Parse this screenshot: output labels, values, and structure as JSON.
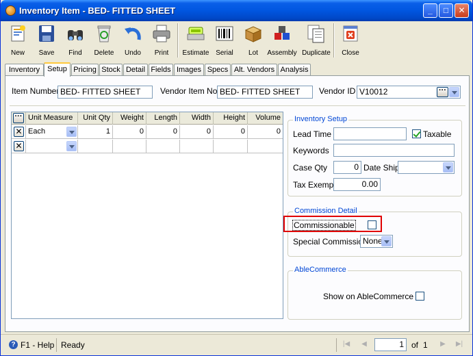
{
  "window": {
    "title": "Inventory Item - BED- FITTED SHEET"
  },
  "toolbar": {
    "new": "New",
    "save": "Save",
    "find": "Find",
    "delete": "Delete",
    "undo": "Undo",
    "print": "Print",
    "estimate": "Estimate",
    "serial": "Serial",
    "lot": "Lot",
    "assembly": "Assembly",
    "duplicate": "Duplicate",
    "close": "Close"
  },
  "tabs": [
    "Inventory",
    "Setup",
    "Pricing",
    "Stock",
    "Detail",
    "Fields",
    "Images",
    "Specs",
    "Alt. Vendors",
    "Analysis"
  ],
  "header": {
    "item_number_label": "Item Number",
    "item_number": "BED- FITTED SHEET",
    "vendor_item_label": "Vendor Item No",
    "vendor_item": "BED- FITTED SHEET",
    "vendor_id_label": "Vendor ID",
    "vendor_id": "V10012"
  },
  "grid": {
    "columns": [
      "Unit Measure",
      "Unit Qty",
      "Weight",
      "Length",
      "Width",
      "Height",
      "Volume"
    ],
    "rows": [
      {
        "unit": "Each",
        "qty": "1",
        "weight": "0",
        "length": "0",
        "width": "0",
        "height": "0",
        "volume": "0"
      },
      {
        "unit": "",
        "qty": "",
        "weight": "",
        "length": "",
        "width": "",
        "height": "",
        "volume": ""
      }
    ]
  },
  "inventory_setup": {
    "title": "Inventory Setup",
    "lead_time_label": "Lead Time",
    "lead_time": "",
    "taxable_label": "Taxable",
    "taxable": true,
    "keywords_label": "Keywords",
    "keywords": "",
    "case_qty_label": "Case Qty",
    "case_qty": "0",
    "date_ship_label": "Date Ship",
    "date_ship": "",
    "tax_exempt_label": "Tax Exempt",
    "tax_exempt": "0.00"
  },
  "commission": {
    "title": "Commission Detail",
    "commissionable_label": "Commissionable",
    "commissionable": false,
    "special_label": "Special Commission",
    "special": "None"
  },
  "ablecommerce": {
    "title": "AbleCommerce",
    "show_label": "Show on AbleCommerce",
    "show": false
  },
  "status": {
    "help": "F1 - Help",
    "text": "Ready",
    "page": "1",
    "of_label": "of",
    "total": "1"
  },
  "colors": {
    "titlebar": "#0054e3",
    "group_title": "#0046d5",
    "highlight": "#e00000"
  }
}
